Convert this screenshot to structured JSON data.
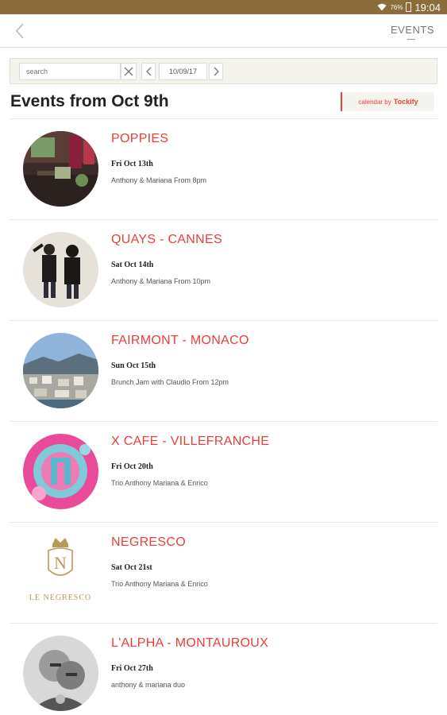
{
  "status_bar": {
    "battery_text": "76%",
    "time": "19:04"
  },
  "top_bar": {
    "back_icon": "chevron-left-icon",
    "events_label": "EVENTS"
  },
  "toolbar": {
    "search_placeholder": "search",
    "date_value": "10/09/17"
  },
  "heading": "Events from Oct 9th",
  "tockify": {
    "prefix": "calendar by",
    "brand": "Tockify"
  },
  "colors": {
    "accent": "#e8403a",
    "status_bar": "#8a6d3b",
    "toolbar_bg": "#f5f3ee"
  },
  "events": [
    {
      "title": "POPPIES",
      "date": "Fri Oct 13th",
      "description": "Anthony & Mariana From 8pm"
    },
    {
      "title": "QUAYS - CANNES",
      "date": "Sat Oct 14th",
      "description": "Anthony & Mariana From 10pm"
    },
    {
      "title": "FAIRMONT - MONACO",
      "date": "Sun Oct 15th",
      "description": "Brunch Jam with Claudio From 12pm"
    },
    {
      "title": "X CAFE - VILLEFRANCHE",
      "date": "Fri Oct 20th",
      "description": "Trio Anthony Mariana & Enrico"
    },
    {
      "title": "NEGRESCO",
      "date": "Sat Oct 21st",
      "description": "Trio Anthony Mariana & Enrico",
      "logo_text": "LE NEGRESCO"
    },
    {
      "title": "L'ALPHA - MONTAUROUX",
      "date": "Fri Oct 27th",
      "description": "anthony & mariana duo"
    }
  ]
}
